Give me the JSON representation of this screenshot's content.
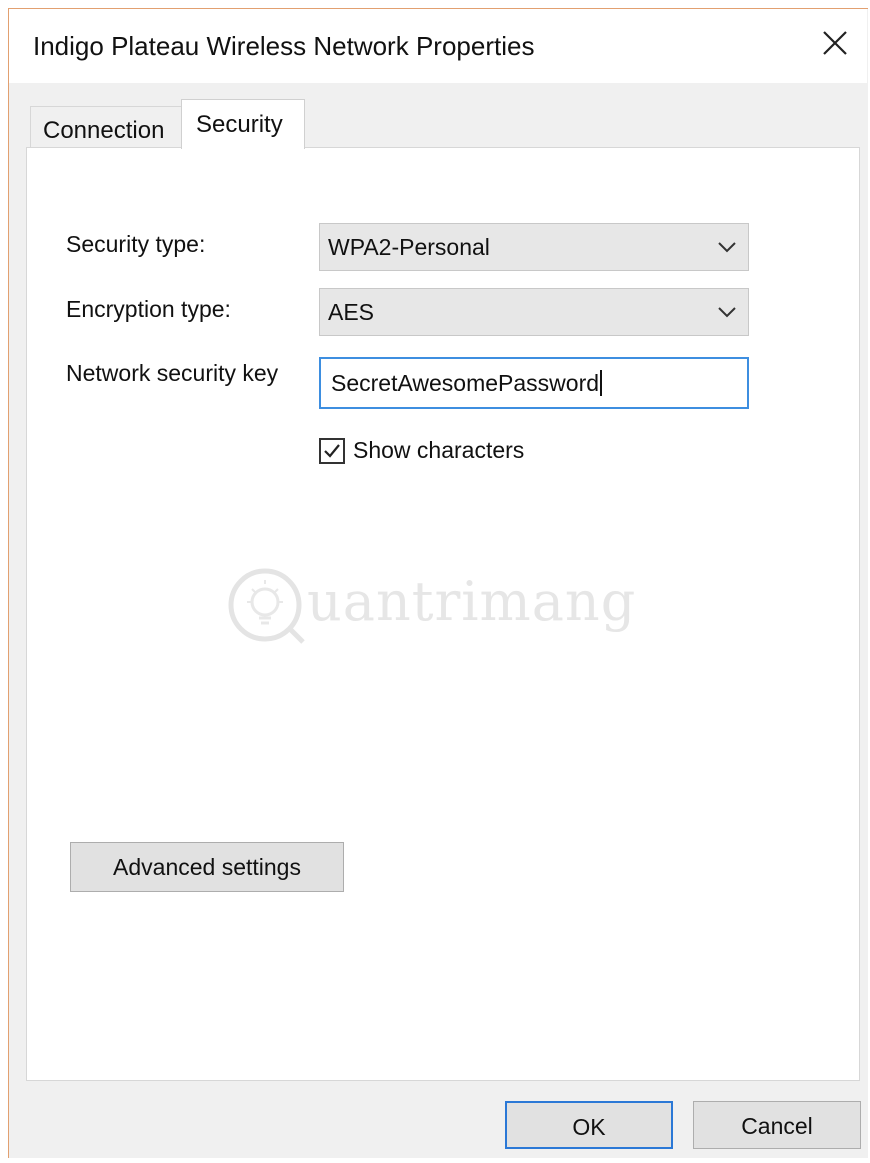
{
  "window": {
    "title": "Indigo Plateau Wireless Network Properties"
  },
  "tabs": [
    {
      "label": "Connection",
      "active": false
    },
    {
      "label": "Security",
      "active": true
    }
  ],
  "security": {
    "security_type_label": "Security type:",
    "security_type_value": "WPA2-Personal",
    "encryption_type_label": "Encryption type:",
    "encryption_type_value": "AES",
    "network_key_label": "Network security key",
    "network_key_value": "SecretAwesomePassword",
    "show_characters_label": "Show characters",
    "show_characters_checked": true
  },
  "buttons": {
    "advanced_settings": "Advanced settings",
    "ok": "OK",
    "cancel": "Cancel"
  },
  "watermark": {
    "text": "uantrimang"
  },
  "colors": {
    "focus_border": "#3d8ee0",
    "default_button_border": "#2b78d6",
    "dialog_background": "#f0f0f0",
    "window_edge": "#e2a070"
  },
  "icons": {
    "close": "close-icon",
    "dropdown": "chevron-down-icon",
    "checkmark": "checkmark-icon",
    "watermark_logo": "lightbulb-icon"
  }
}
